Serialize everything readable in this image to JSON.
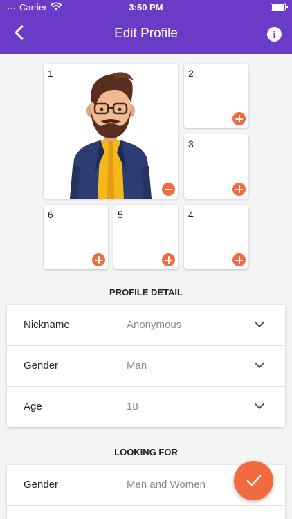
{
  "status_bar": {
    "signal": "....",
    "carrier": "Carrier",
    "time": "3:50 PM"
  },
  "nav": {
    "title": "Edit Profile",
    "back_icon": "chevron-left-icon",
    "info_icon": "info-icon"
  },
  "photos": [
    {
      "number": "1",
      "action": "remove",
      "has_photo": true
    },
    {
      "number": "2",
      "action": "add",
      "has_photo": false
    },
    {
      "number": "3",
      "action": "add",
      "has_photo": false
    },
    {
      "number": "6",
      "action": "add",
      "has_photo": false
    },
    {
      "number": "5",
      "action": "add",
      "has_photo": false
    },
    {
      "number": "4",
      "action": "add",
      "has_photo": false
    }
  ],
  "profile_detail": {
    "title": "PROFILE DETAIL",
    "rows": [
      {
        "label": "Nickname",
        "value": "Anonymous"
      },
      {
        "label": "Gender",
        "value": "Man"
      },
      {
        "label": "Age",
        "value": "18"
      }
    ]
  },
  "looking_for": {
    "title": "LOOKING FOR",
    "rows": [
      {
        "label": "Gender",
        "value": "Men and Women"
      }
    ]
  },
  "colors": {
    "nav_background": "#6a3bc7",
    "accent": "#f26a3f",
    "page_background": "#f4f4f4"
  },
  "fab_icon": "checkmark-icon"
}
